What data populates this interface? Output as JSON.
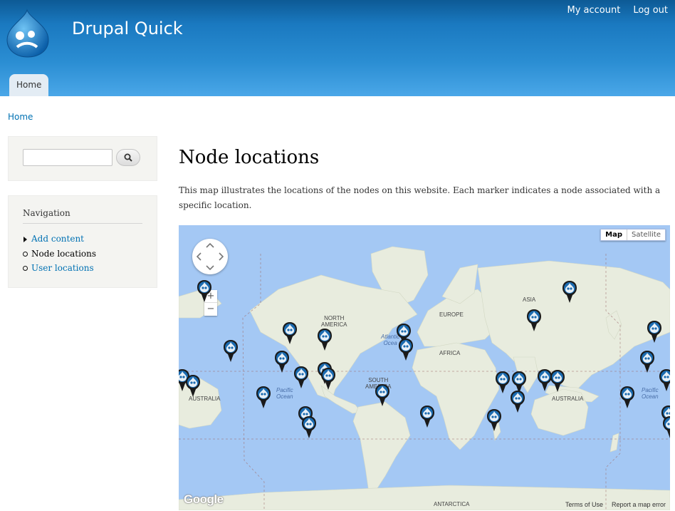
{
  "header": {
    "site_name": "Drupal Quick",
    "secondary_menu": [
      "My account",
      "Log out"
    ],
    "main_tab": "Home"
  },
  "breadcrumb": "Home",
  "sidebar": {
    "search_placeholder": "",
    "navigation_title": "Navigation",
    "nav_items": [
      {
        "label": "Add content"
      },
      {
        "label": "Node locations"
      },
      {
        "label": "User locations"
      }
    ]
  },
  "main": {
    "title": "Node locations",
    "description": "This map illustrates the locations of the nodes on this website. Each marker indicates a node associated with a specific location."
  },
  "map": {
    "map_type_buttons": [
      "Map",
      "Satellite"
    ],
    "zoom_in": "+",
    "zoom_out": "−",
    "google_logo": "Google",
    "footer_links": [
      "Terms of Use",
      "Report a map error"
    ],
    "labels": {
      "north_america": "NORTH\nAMERICA",
      "europe": "EUROPE",
      "asia": "ASIA",
      "africa": "AFRICA",
      "south_america": "SOUTH\nAMERICA",
      "australia_left": "AUSTRALIA",
      "australia": "AUSTRALIA",
      "antarctica": "ANTARCTICA",
      "atlantic": "Atlantic\nOcea",
      "pacific_left": "Pacific\nOcean",
      "pacific_right": "Pacific\nOcean"
    },
    "marker_icon": "drupal-drop-marker-icon",
    "colors": {
      "water": "#a4c8f4",
      "land": "#e8ecde",
      "marker": "#1b6bb0"
    }
  }
}
